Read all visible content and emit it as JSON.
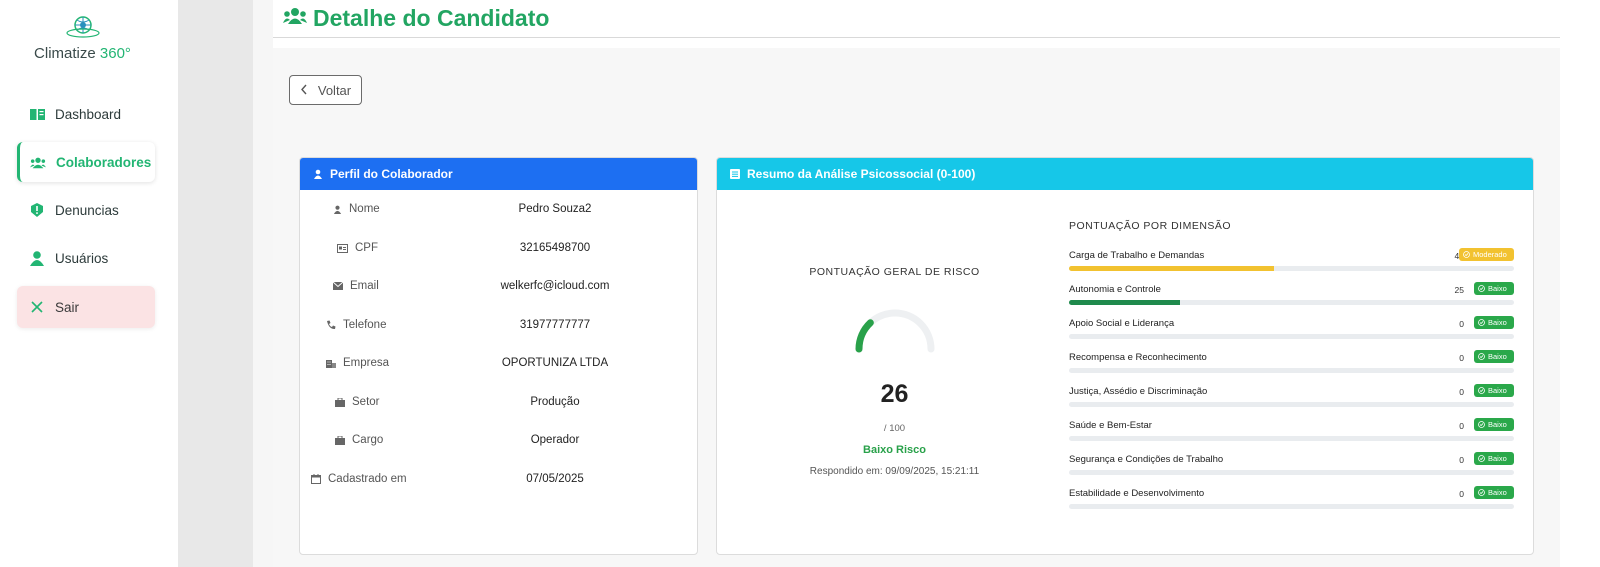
{
  "brand": {
    "name": "Climatize",
    "suffix": "360°"
  },
  "sidebar": {
    "items": [
      {
        "label": "Dashboard",
        "icon": "book-icon"
      },
      {
        "label": "Colaboradores",
        "icon": "users-icon"
      },
      {
        "label": "Denuncias",
        "icon": "alert-icon"
      },
      {
        "label": "Usuários",
        "icon": "user-icon"
      },
      {
        "label": "Sair",
        "icon": "close-icon"
      }
    ]
  },
  "header": {
    "title": "Detalhe do Candidato"
  },
  "back_label": "Voltar",
  "profile": {
    "title": "Perfil do Colaborador",
    "fields": [
      {
        "label": "Nome",
        "value": "Pedro Souza2"
      },
      {
        "label": "CPF",
        "value": "32165498700"
      },
      {
        "label": "Email",
        "value": "welkerfc@icloud.com"
      },
      {
        "label": "Telefone",
        "value": "31977777777"
      },
      {
        "label": "Empresa",
        "value": "OPORTUNIZA LTDA"
      },
      {
        "label": "Setor",
        "value": "Produção"
      },
      {
        "label": "Cargo",
        "value": "Operador"
      },
      {
        "label": "Cadastrado em",
        "value": "07/05/2025"
      }
    ]
  },
  "summary": {
    "title": "Resumo da Análise Psicossocial (0-100)",
    "gauge_title": "PONTUAÇÃO GERAL DE RISCO",
    "score": "26",
    "score_value": 26,
    "score_max": "/ 100",
    "risk_label": "Baixo Risco",
    "answered": "Respondido em: 09/09/2025, 15:21:11",
    "dims_title": "PONTUAÇÃO POR DIMENSÃO",
    "dimensions": [
      {
        "label": "Carga de Trabalho e Demandas",
        "score": "46",
        "badge": "Moderado",
        "level": "mod",
        "color": "#f2c230",
        "value": 46
      },
      {
        "label": "Autonomia e Controle",
        "score": "25",
        "badge": "Baixo",
        "level": "low",
        "color": "#1f8a4c",
        "value": 25
      },
      {
        "label": "Apoio Social e Liderança",
        "score": "0",
        "badge": "Baixo",
        "level": "low",
        "color": "#1f8a4c",
        "value": 0
      },
      {
        "label": "Recompensa e Reconhecimento",
        "score": "0",
        "badge": "Baixo",
        "level": "low",
        "color": "#1f8a4c",
        "value": 0
      },
      {
        "label": "Justiça, Assédio e Discriminação",
        "score": "0",
        "badge": "Baixo",
        "level": "low",
        "color": "#1f8a4c",
        "value": 0
      },
      {
        "label": "Saúde e Bem-Estar",
        "score": "0",
        "badge": "Baixo",
        "level": "low",
        "color": "#1f8a4c",
        "value": 0
      },
      {
        "label": "Segurança e Condições de Trabalho",
        "score": "0",
        "badge": "Baixo",
        "level": "low",
        "color": "#1f8a4c",
        "value": 0
      },
      {
        "label": "Estabilidade e Desenvolvimento",
        "score": "0",
        "badge": "Baixo",
        "level": "low",
        "color": "#1f8a4c",
        "value": 0
      }
    ]
  },
  "colors": {
    "accent": "#22b573",
    "primary": "#1d6ff2",
    "info": "#16c7e8",
    "success": "#2aa84a",
    "warning": "#f2c230"
  }
}
